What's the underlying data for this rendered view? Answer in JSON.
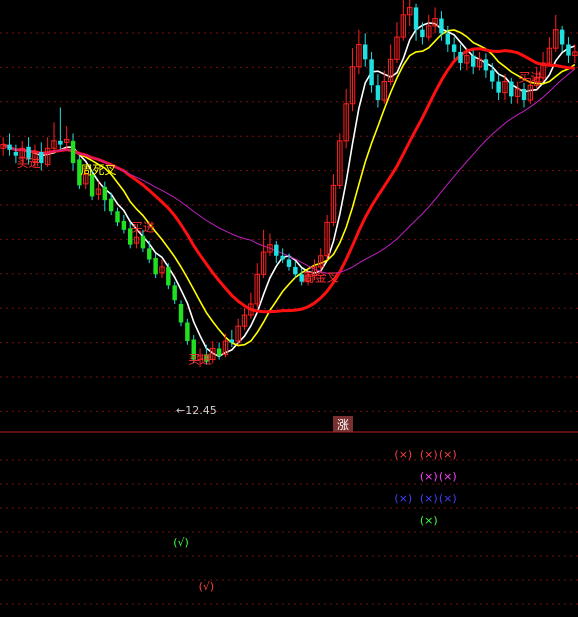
{
  "chart_data": [
    {
      "type": "candlestick",
      "title": "",
      "xlabel": "",
      "ylabel": "",
      "ylim": [
        11.6,
        17.4
      ],
      "grid": true,
      "price_label": "←12.45",
      "annotations": [
        {
          "text": "买进",
          "bar": 4,
          "price": 15.15,
          "color": "#ff3030"
        },
        {
          "text": "周死叉",
          "bar": 15,
          "price": 15.05,
          "color": "#ffff00"
        },
        {
          "text": "买进",
          "bar": 22,
          "price": 14.28,
          "color": "#ff3030"
        },
        {
          "text": "买进",
          "bar": 31,
          "price": 12.5,
          "color": "#ff3030"
        },
        {
          "text": "周金叉",
          "bar": 50,
          "price": 13.6,
          "color": "#ff3030"
        },
        {
          "text": "买进",
          "bar": 83,
          "price": 16.3,
          "color": "#ff3030"
        }
      ],
      "candles": [
        [
          15.4,
          15.45,
          15.55,
          15.3
        ],
        [
          15.45,
          15.38,
          15.6,
          15.3
        ],
        [
          15.35,
          15.3,
          15.45,
          15.2
        ],
        [
          15.28,
          15.4,
          15.5,
          15.2
        ],
        [
          15.42,
          15.25,
          15.55,
          15.18
        ],
        [
          15.22,
          15.35,
          15.45,
          15.15
        ],
        [
          15.35,
          15.2,
          15.48,
          15.1
        ],
        [
          15.18,
          15.4,
          15.55,
          15.15
        ],
        [
          15.4,
          15.5,
          15.75,
          15.35
        ],
        [
          15.5,
          15.45,
          15.95,
          15.38
        ],
        [
          15.48,
          15.52,
          15.7,
          15.4
        ],
        [
          15.5,
          15.2,
          15.6,
          15.1
        ],
        [
          15.25,
          14.9,
          15.3,
          14.85
        ],
        [
          14.92,
          15.05,
          15.15,
          14.85
        ],
        [
          15.05,
          14.75,
          15.1,
          14.7
        ],
        [
          14.78,
          14.85,
          14.95,
          14.7
        ],
        [
          14.88,
          14.7,
          14.95,
          14.55
        ],
        [
          14.72,
          14.55,
          14.8,
          14.5
        ],
        [
          14.55,
          14.4,
          14.6,
          14.35
        ],
        [
          14.42,
          14.3,
          14.5,
          14.25
        ],
        [
          14.32,
          14.1,
          14.4,
          14.05
        ],
        [
          14.12,
          14.2,
          14.3,
          14.05
        ],
        [
          14.22,
          14.05,
          14.3,
          14.0
        ],
        [
          14.05,
          13.9,
          14.15,
          13.85
        ],
        [
          13.92,
          13.7,
          13.98,
          13.65
        ],
        [
          13.72,
          13.8,
          13.9,
          13.65
        ],
        [
          13.8,
          13.55,
          13.85,
          13.5
        ],
        [
          13.55,
          13.35,
          13.6,
          13.3
        ],
        [
          13.3,
          13.05,
          13.35,
          13.0
        ],
        [
          13.05,
          12.8,
          13.1,
          12.75
        ],
        [
          12.82,
          12.55,
          12.88,
          12.5
        ],
        [
          12.55,
          12.6,
          12.7,
          12.45
        ],
        [
          12.62,
          12.52,
          12.75,
          12.48
        ],
        [
          12.55,
          12.7,
          12.8,
          12.5
        ],
        [
          12.7,
          12.6,
          12.78,
          12.55
        ],
        [
          12.62,
          12.8,
          12.9,
          12.58
        ],
        [
          12.82,
          12.78,
          12.95,
          12.72
        ],
        [
          12.8,
          13.0,
          13.1,
          12.75
        ],
        [
          13.0,
          13.15,
          13.25,
          12.95
        ],
        [
          13.15,
          13.3,
          13.45,
          13.1
        ],
        [
          13.3,
          13.7,
          13.85,
          13.25
        ],
        [
          13.7,
          14.0,
          14.3,
          13.65
        ],
        [
          14.0,
          14.1,
          14.25,
          13.95
        ],
        [
          14.1,
          13.95,
          14.15,
          13.85
        ],
        [
          13.95,
          13.9,
          14.05,
          13.85
        ],
        [
          13.9,
          13.8,
          13.98,
          13.75
        ],
        [
          13.8,
          13.7,
          13.88,
          13.65
        ],
        [
          13.7,
          13.6,
          13.78,
          13.55
        ],
        [
          13.6,
          13.68,
          13.75,
          13.55
        ],
        [
          13.68,
          13.8,
          13.9,
          13.62
        ],
        [
          13.8,
          13.95,
          14.05,
          13.75
        ],
        [
          13.95,
          14.4,
          14.5,
          13.9
        ],
        [
          14.4,
          14.9,
          15.05,
          14.35
        ],
        [
          14.9,
          15.5,
          15.6,
          14.85
        ],
        [
          15.5,
          16.0,
          16.2,
          15.4
        ],
        [
          16.0,
          16.5,
          16.75,
          15.9
        ],
        [
          16.5,
          16.8,
          17.0,
          16.4
        ],
        [
          16.8,
          16.6,
          16.95,
          16.5
        ],
        [
          16.6,
          16.25,
          16.7,
          16.15
        ],
        [
          16.25,
          16.05,
          16.4,
          15.95
        ],
        [
          16.05,
          16.3,
          16.45,
          16.0
        ],
        [
          16.3,
          16.6,
          16.8,
          16.25
        ],
        [
          16.6,
          16.9,
          17.1,
          16.55
        ],
        [
          16.9,
          17.2,
          17.4,
          16.85
        ],
        [
          17.2,
          17.3,
          17.5,
          17.05
        ],
        [
          17.3,
          17.0,
          17.35,
          16.85
        ],
        [
          17.0,
          16.9,
          17.1,
          16.8
        ],
        [
          16.9,
          17.05,
          17.2,
          16.85
        ],
        [
          17.05,
          17.15,
          17.3,
          16.95
        ],
        [
          17.15,
          16.95,
          17.25,
          16.85
        ],
        [
          16.95,
          16.8,
          17.05,
          16.7
        ],
        [
          16.8,
          16.7,
          16.9,
          16.6
        ],
        [
          16.7,
          16.55,
          16.8,
          16.45
        ],
        [
          16.55,
          16.65,
          16.75,
          16.45
        ],
        [
          16.65,
          16.5,
          16.72,
          16.4
        ],
        [
          16.5,
          16.6,
          16.7,
          16.45
        ],
        [
          16.6,
          16.45,
          16.68,
          16.35
        ],
        [
          16.45,
          16.3,
          16.55,
          16.2
        ],
        [
          16.3,
          16.15,
          16.4,
          16.05
        ],
        [
          16.15,
          16.3,
          16.4,
          16.05
        ],
        [
          16.3,
          16.1,
          16.35,
          16.0
        ],
        [
          16.1,
          16.2,
          16.3,
          16.0
        ],
        [
          16.2,
          16.05,
          16.28,
          15.95
        ],
        [
          16.05,
          16.25,
          16.35,
          16.0
        ],
        [
          16.25,
          16.35,
          16.5,
          16.2
        ],
        [
          16.35,
          16.55,
          16.7,
          16.3
        ],
        [
          16.55,
          16.75,
          16.9,
          16.5
        ],
        [
          16.75,
          17.0,
          17.2,
          16.7
        ],
        [
          17.0,
          16.8,
          17.05,
          16.7
        ],
        [
          16.8,
          16.65,
          16.9,
          16.55
        ],
        [
          16.65,
          16.7,
          16.8,
          16.55
        ]
      ]
    },
    {
      "type": "signal_panel",
      "header_label": "涨",
      "markers": [
        {
          "text": "(×)",
          "bar": 63,
          "row": 1,
          "color": "#ff4040"
        },
        {
          "text": "(×)",
          "bar": 67,
          "row": 1,
          "color": "#ff4040"
        },
        {
          "text": "(×)",
          "bar": 70,
          "row": 1,
          "color": "#ff4040"
        },
        {
          "text": "(×)",
          "bar": 67,
          "row": 2,
          "color": "#ff40ff"
        },
        {
          "text": "(×)",
          "bar": 70,
          "row": 2,
          "color": "#ff40ff"
        },
        {
          "text": "(×)",
          "bar": 63,
          "row": 3,
          "color": "#4040ff"
        },
        {
          "text": "(×)",
          "bar": 67,
          "row": 3,
          "color": "#4040ff"
        },
        {
          "text": "(×)",
          "bar": 70,
          "row": 3,
          "color": "#4040ff"
        },
        {
          "text": "(×)",
          "bar": 67,
          "row": 4,
          "color": "#40ff40"
        },
        {
          "text": "(√)",
          "bar": 28,
          "row": 5,
          "color": "#40ff40"
        },
        {
          "text": "(√)",
          "bar": 32,
          "row": 7,
          "color": "#ff4040"
        }
      ]
    }
  ]
}
